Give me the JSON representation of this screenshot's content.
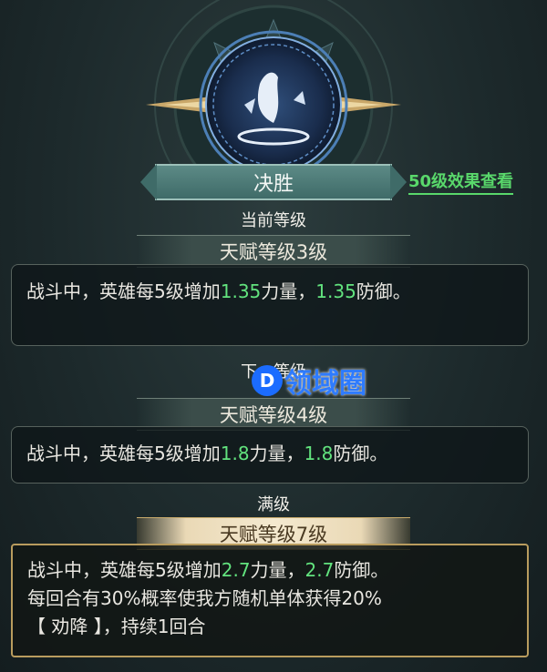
{
  "skill": {
    "name": "决胜",
    "view_link": "50级效果查看"
  },
  "current": {
    "section_title": "当前等级",
    "level_label": "天赋等级3级",
    "desc_pre": "战斗中，英雄每5级增加",
    "value1": "1.35",
    "desc_mid": "力量，",
    "value2": "1.35",
    "desc_post": "防御。"
  },
  "next": {
    "section_title": "下一等级",
    "level_label": "天赋等级4级",
    "desc_pre": "战斗中，英雄每5级增加",
    "value1": "1.8",
    "desc_mid": "力量，",
    "value2": "1.8",
    "desc_post": "防御。"
  },
  "max": {
    "section_title": "满级",
    "level_label": "天赋等级7级",
    "desc_pre": "战斗中，英雄每5级增加",
    "value1": "2.7",
    "desc_mid": "力量，",
    "value2": "2.7",
    "desc_post": "防御。",
    "extra_line1": "每回合有30%概率使我方随机单体获得20%",
    "extra_line2": "【 劝降 】，持续1回合"
  },
  "watermark": {
    "logo": "D",
    "text": "领域圈"
  },
  "colors": {
    "highlight": "#62e37e",
    "link": "#59d86b",
    "gold_border": "#b99c5e"
  }
}
